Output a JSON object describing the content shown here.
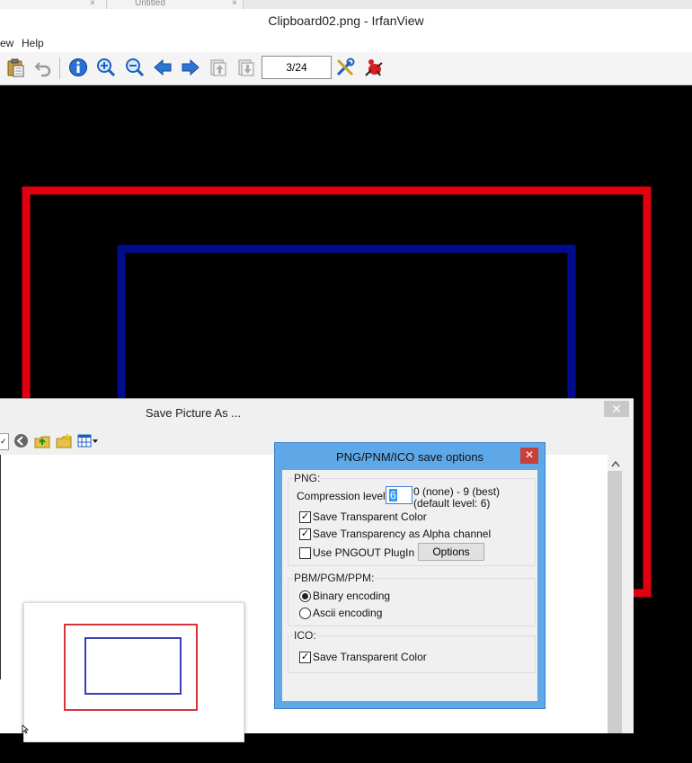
{
  "window": {
    "title": "Clipboard02.png - IrfanView",
    "tab_fragment_left": "",
    "tab_fragment_right": "Untitled"
  },
  "menu": {
    "items": [
      "ew",
      "Help"
    ]
  },
  "toolbar": {
    "page_indicator": "3/24",
    "icons": [
      "paste-icon",
      "undo-icon",
      "info-icon",
      "zoom-in-icon",
      "zoom-out-icon",
      "previous-icon",
      "next-icon",
      "page-up-icon",
      "page-down-icon",
      "settings-icon",
      "irfanview-logo-icon"
    ]
  },
  "save_dialog": {
    "title": "Save Picture As ...",
    "close_label": "✕",
    "thumbnail_filename": "Clipboard02.png"
  },
  "png_dialog": {
    "title": "PNG/PNM/ICO save options",
    "close_label": "✕",
    "png_group": {
      "label": "PNG:",
      "compression_label": "Compression level:",
      "compression_value": "6",
      "compression_hint_1": "0 (none) - 9 (best)",
      "compression_hint_2": "(default level: 6)",
      "save_transparent_color": "Save Transparent Color",
      "save_transparent_color_checked": true,
      "save_alpha": "Save Transparency as Alpha channel",
      "save_alpha_checked": true,
      "use_pngout": "Use PNGOUT PlugIn",
      "use_pngout_checked": false,
      "options_button": "Options"
    },
    "pbm_group": {
      "label": "PBM/PGM/PPM:",
      "binary": "Binary encoding",
      "binary_selected": true,
      "ascii": "Ascii encoding"
    },
    "ico_group": {
      "label": "ICO:",
      "save_transparent_color": "Save Transparent Color",
      "save_transparent_color_checked": true
    }
  },
  "colors": {
    "outer_rect": "#e0000f",
    "inner_rect": "#000c8c",
    "dialog_frame": "#5ea8e8",
    "close_red": "#c9403a"
  }
}
